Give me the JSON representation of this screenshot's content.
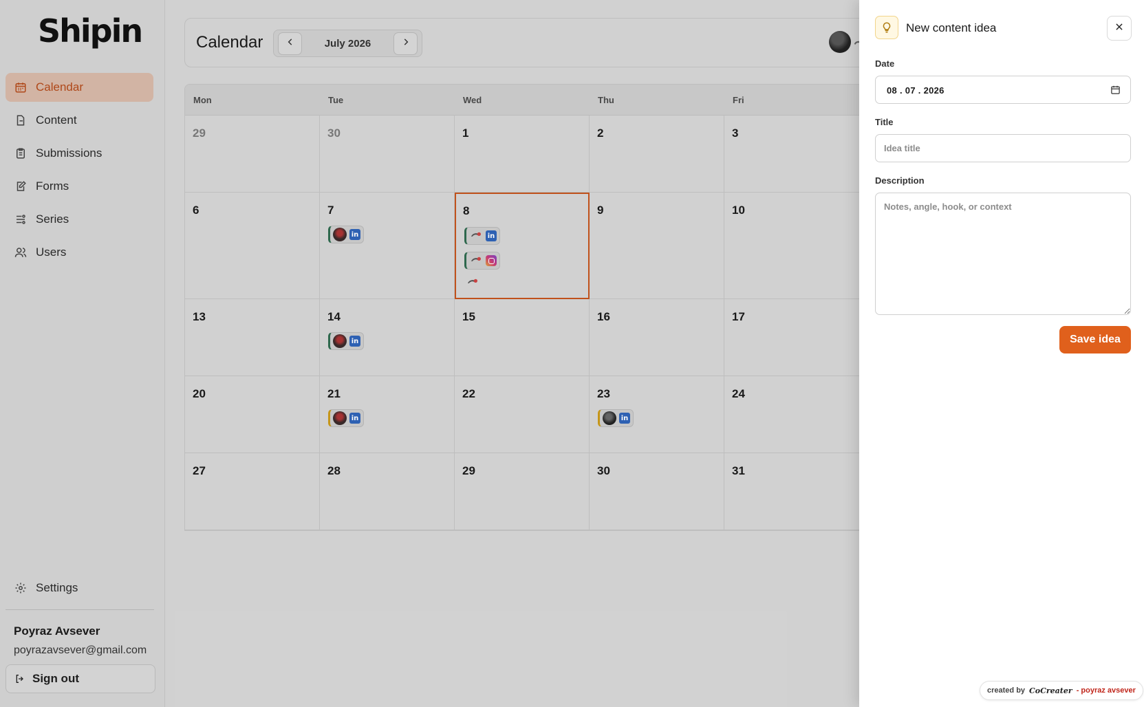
{
  "app": {
    "logo": "Shipin"
  },
  "sidebar": {
    "items": [
      {
        "label": "Calendar",
        "icon": "calendar-icon",
        "active": true
      },
      {
        "label": "Content",
        "icon": "document-icon",
        "active": false
      },
      {
        "label": "Submissions",
        "icon": "clipboard-icon",
        "active": false
      },
      {
        "label": "Forms",
        "icon": "edit-form-icon",
        "active": false
      },
      {
        "label": "Series",
        "icon": "series-icon",
        "active": false
      },
      {
        "label": "Users",
        "icon": "users-icon",
        "active": false
      }
    ],
    "settings_label": "Settings",
    "user": {
      "name": "Poyraz Avsever",
      "email": "poyrazavsever@gmail.com"
    },
    "signout_label": "Sign out"
  },
  "header": {
    "title": "Calendar",
    "month_label": "July 2026"
  },
  "calendar": {
    "weekdays": [
      "Mon",
      "Tue",
      "Wed",
      "Thu",
      "Fri"
    ],
    "weeks": [
      [
        "29",
        "30",
        "1",
        "2",
        "3"
      ],
      [
        "6",
        "7",
        "8",
        "9",
        "10"
      ],
      [
        "13",
        "14",
        "15",
        "16",
        "17"
      ],
      [
        "20",
        "21",
        "22",
        "23",
        "24"
      ],
      [
        "27",
        "28",
        "29",
        "30",
        "31"
      ]
    ],
    "muted_days": [
      "29",
      "30"
    ],
    "selected_day": "8",
    "posts": [
      {
        "day": "7",
        "platform": "linkedin-icon",
        "author": "avatar"
      },
      {
        "day": "8",
        "platform": "linkedin-icon",
        "author": "brand-logo"
      },
      {
        "day": "8",
        "platform": "instagram-icon",
        "author": "brand-logo"
      },
      {
        "day": "14",
        "platform": "linkedin-icon",
        "author": "avatar"
      },
      {
        "day": "21",
        "platform": "linkedin-icon",
        "author": "avatar"
      },
      {
        "day": "23",
        "platform": "linkedin-icon",
        "author": "avatar"
      }
    ],
    "colors": {
      "accent": "#c4531c",
      "published": "#2f6b4f",
      "scheduled": "#c99a1a"
    }
  },
  "panel": {
    "title": "New content idea",
    "icon": "lightbulb-icon",
    "date_label": "Date",
    "date_value": "08 . 07 . 2026",
    "title_label": "Title",
    "title_placeholder": "Idea title",
    "description_label": "Description",
    "description_placeholder": "Notes, angle, hook, or context",
    "save_label": "Save idea",
    "save_color": "#e0601c"
  },
  "credit": {
    "prefix": "created by",
    "brand": "CoCreater",
    "author": "- poyraz avsever"
  }
}
